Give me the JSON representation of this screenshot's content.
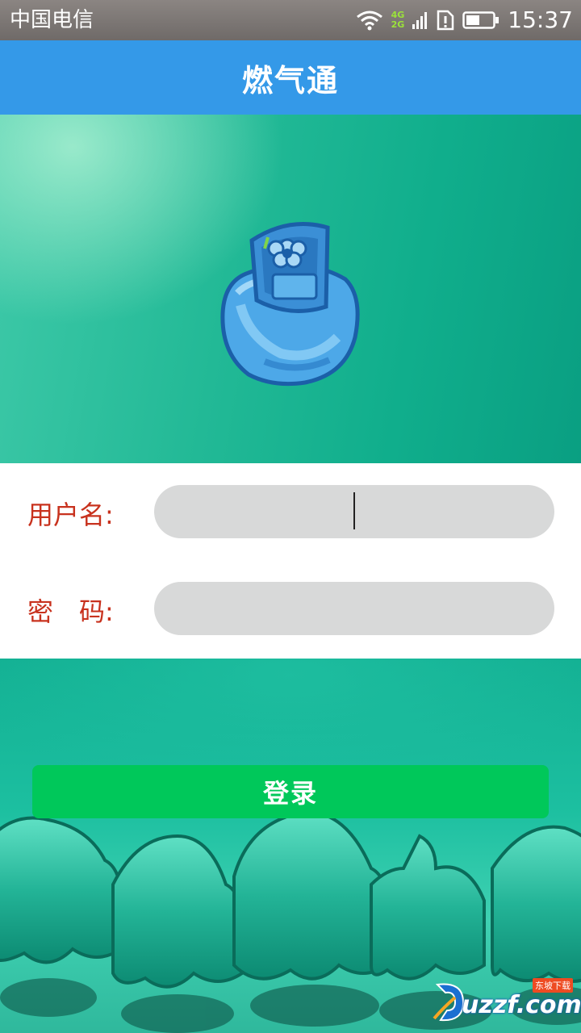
{
  "status_bar": {
    "carrier": "中国电信",
    "network_top": "4G",
    "network_bottom": "2G",
    "time": "15:37",
    "icons": [
      "wifi-icon",
      "signal-icon",
      "sim-alert-icon",
      "battery-icon"
    ]
  },
  "app": {
    "title": "燃气通",
    "accent_color": "#3499e8"
  },
  "hero": {
    "logo_icon": "gas-cylinder-icon"
  },
  "form": {
    "username_label": "用户名:",
    "password_label": "密　码:",
    "username_value": "",
    "password_value": "",
    "label_color": "#c8321e"
  },
  "actions": {
    "login_label": "登录",
    "login_color": "#00c85a"
  },
  "watermark": {
    "text": "uzzf.com",
    "badge": "东坡下载"
  }
}
